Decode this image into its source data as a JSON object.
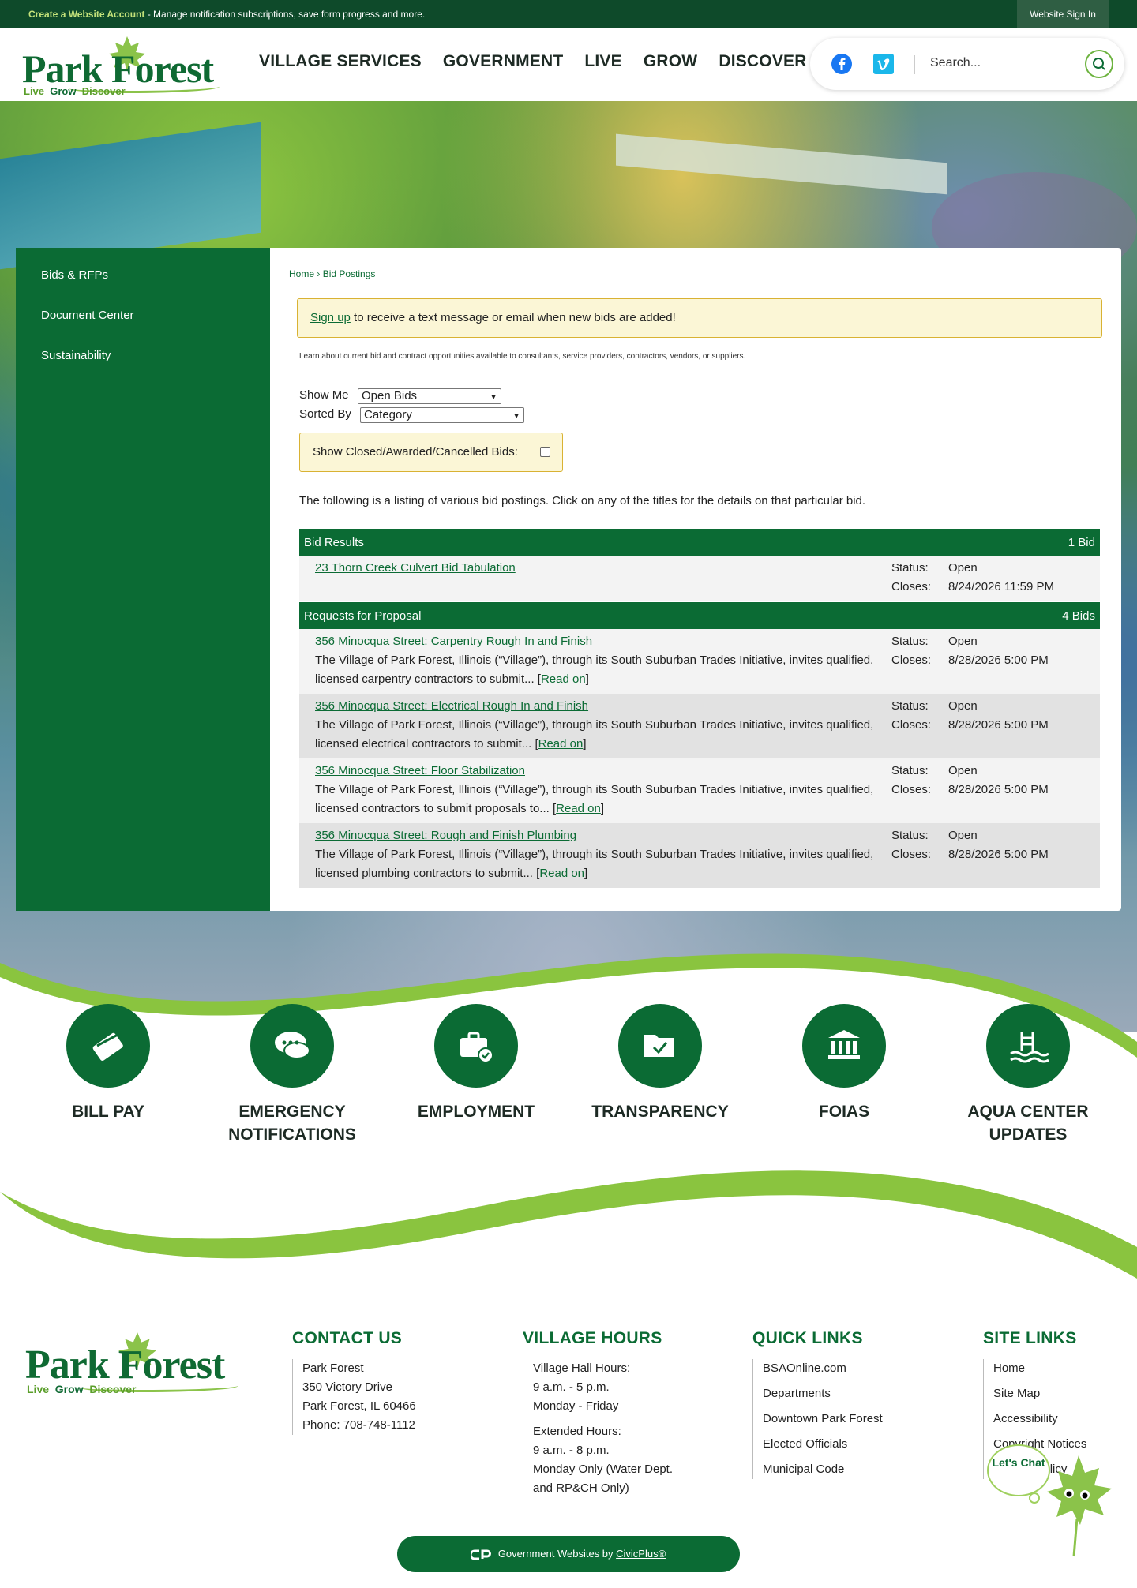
{
  "topbar": {
    "create_account": "Create a Website Account",
    "message": " - Manage notification subscriptions, save form progress and more.",
    "sign_in": "Website Sign In"
  },
  "header": {
    "logo": {
      "word": "Park Forest",
      "tag_1": "Live",
      "tag_2": "Grow",
      "tag_3": "Discover"
    },
    "nav": [
      "VILLAGE SERVICES",
      "GOVERNMENT",
      "LIVE",
      "GROW",
      "DISCOVER"
    ],
    "search_placeholder": "Search...",
    "social": [
      "facebook-icon",
      "vimeo-icon"
    ]
  },
  "sidebar": {
    "items": [
      "Bids & RFPs",
      "Document Center",
      "Sustainability"
    ]
  },
  "main": {
    "breadcrumb": {
      "home": "Home",
      "sep": " › ",
      "current": "Bid Postings"
    },
    "alert": {
      "link": "Sign up",
      "text": " to receive a text message or email when new bids are added!"
    },
    "intro": "Learn about current bid and contract opportunities available to consultants, service providers, contractors, vendors, or suppliers.",
    "show_me_label": "Show Me",
    "show_me_value": "Open Bids",
    "sorted_by_label": "Sorted By",
    "sorted_by_value": "Category",
    "show_closed_label": "Show Closed/Awarded/Cancelled Bids:",
    "show_closed_checked": false,
    "listing_text": "The following is a listing of various bid postings. Click on any of the titles for the details on that particular bid.",
    "groups": [
      {
        "name": "Bid Results",
        "count": "1 Bid",
        "items": [
          {
            "title": "23 Thorn Creek Culvert Bid Tabulation",
            "desc": "",
            "status": "Open",
            "closes": "8/24/2026 11:59 PM"
          }
        ]
      },
      {
        "name": "Requests for Proposal",
        "count": "4 Bids",
        "items": [
          {
            "title": "356 Minocqua Street: Carpentry Rough In and Finish",
            "desc": "The Village of Park Forest, Illinois (“Village”), through its South Suburban Trades Initiative, invites qualified, licensed carpentry contractors to submit...",
            "status": "Open",
            "closes": "8/28/2026 5:00 PM"
          },
          {
            "title": "356 Minocqua Street: Electrical Rough In and Finish",
            "desc": "The Village of Park Forest, Illinois (“Village”), through its South Suburban Trades Initiative, invites qualified, licensed electrical contractors to submit...",
            "status": "Open",
            "closes": "8/28/2026 5:00 PM"
          },
          {
            "title": "356 Minocqua Street: Floor Stabilization",
            "desc": "The Village of Park Forest, Illinois (“Village”), through its South Suburban Trades Initiative, invites qualified, licensed contractors to submit proposals to...",
            "status": "Open",
            "closes": "8/28/2026 5:00 PM"
          },
          {
            "title": "356 Minocqua Street: Rough and Finish Plumbing",
            "desc": "The Village of Park Forest, Illinois (“Village”), through its South Suburban Trades Initiative, invites qualified, licensed plumbing contractors to submit...",
            "status": "Open",
            "closes": "8/28/2026 5:00 PM"
          }
        ]
      }
    ],
    "status_label": "Status:",
    "closes_label": "Closes:",
    "read_on": "Read on"
  },
  "quick_links": [
    {
      "label_1": "BILL PAY",
      "label_2": "",
      "icon": "bill-pay-icon"
    },
    {
      "label_1": "EMERGENCY",
      "label_2": "NOTIFICATIONS",
      "icon": "chat-bubbles-icon"
    },
    {
      "label_1": "EMPLOYMENT",
      "label_2": "",
      "icon": "briefcase-icon"
    },
    {
      "label_1": "TRANSPARENCY",
      "label_2": "",
      "icon": "folder-check-icon"
    },
    {
      "label_1": "FOIAS",
      "label_2": "",
      "icon": "government-building-icon"
    },
    {
      "label_1": "AQUA CENTER",
      "label_2": "UPDATES",
      "icon": "pool-icon"
    }
  ],
  "footer": {
    "contact": {
      "heading": "CONTACT US",
      "lines": [
        "Park Forest",
        "350 Victory Drive",
        "Park Forest, IL 60466",
        "Phone: 708-748-1112"
      ]
    },
    "hours": {
      "heading": "VILLAGE HOURS",
      "block1": [
        "Village Hall Hours:",
        "9 a.m. - 5 p.m.",
        "Monday - Friday"
      ],
      "block2": [
        "Extended Hours:",
        "9 a.m. - 8 p.m.",
        "Monday Only (Water Dept.",
        "and RP&CH Only)"
      ]
    },
    "quick_links": {
      "heading": "QUICK LINKS",
      "items": [
        "BSAOnline.com",
        "Departments",
        "Downtown Park Forest",
        "Elected Officials",
        "Municipal Code"
      ]
    },
    "site_links": {
      "heading": "SITE LINKS",
      "items": [
        "Home",
        "Site Map",
        "Accessibility",
        "Copyright Notices",
        "Privacy Policy"
      ]
    },
    "chat": "Let's Chat",
    "civic_prefix": "Government Websites by ",
    "civic_link": "CivicPlus®"
  },
  "colors": {
    "brand_green": "#0b6b34",
    "accent_green": "#8bc34a",
    "alert_bg": "#fbf6d6",
    "alert_border": "#d9b233"
  }
}
